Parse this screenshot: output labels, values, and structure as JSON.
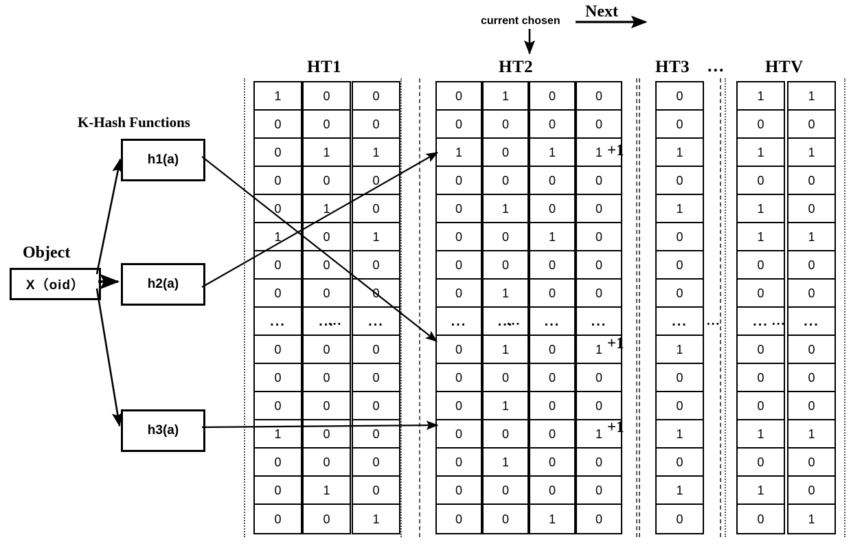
{
  "diagram": {
    "title_labels": {
      "k_hash": "K-Hash Functions",
      "object": "Object",
      "next": "Next",
      "current_chosen": "current chosen"
    },
    "object_box": {
      "label": "X（oid）"
    },
    "hash_boxes": [
      {
        "label": "h1(a)"
      },
      {
        "label": "h2(a)"
      },
      {
        "label": "h3(a)"
      }
    ],
    "ellipsis": "...",
    "plus_one": "+1",
    "group_ellipsis_between_ht3_htv": "...",
    "tables": [
      {
        "name": "HT1",
        "columns": [
          {
            "cells": [
              "1",
              "0",
              "0",
              "0",
              "0",
              "1",
              "0",
              "0",
              "...",
              "0",
              "0",
              "0",
              "1",
              "0",
              "0",
              "0"
            ]
          },
          {
            "cells": [
              "0",
              "0",
              "1",
              "0",
              "1",
              "0",
              "0",
              "0",
              "...",
              "0",
              "0",
              "0",
              "0",
              "0",
              "1",
              "0"
            ]
          },
          {
            "cells": [
              "0",
              "0",
              "1",
              "0",
              "0",
              "1",
              "0",
              "0",
              "...",
              "0",
              "0",
              "0",
              "0",
              "0",
              "0",
              "1"
            ]
          }
        ],
        "gap_after_column": 2
      },
      {
        "name": "HT2",
        "columns": [
          {
            "cells": [
              "0",
              "0",
              "1",
              "0",
              "0",
              "0",
              "0",
              "0",
              "...",
              "0",
              "0",
              "0",
              "0",
              "0",
              "0",
              "0"
            ]
          },
          {
            "cells": [
              "1",
              "0",
              "0",
              "0",
              "1",
              "0",
              "0",
              "1",
              "...",
              "1",
              "0",
              "1",
              "0",
              "1",
              "0",
              "0"
            ]
          },
          {
            "cells": [
              "0",
              "0",
              "1",
              "0",
              "0",
              "1",
              "0",
              "0",
              "...",
              "0",
              "0",
              "0",
              "0",
              "0",
              "0",
              "1"
            ]
          },
          {
            "cells": [
              "0",
              "0",
              "1",
              "0",
              "0",
              "0",
              "0",
              "0",
              "...",
              "1",
              "0",
              "0",
              "1",
              "0",
              "0",
              "0"
            ]
          }
        ],
        "gap_after_column": 2,
        "increment_rows": [
          3,
          10,
          14
        ]
      },
      {
        "name": "HT3",
        "columns": [
          {
            "cells": [
              "0",
              "0",
              "1",
              "0",
              "1",
              "0",
              "0",
              "0",
              "...",
              "1",
              "0",
              "0",
              "1",
              "0",
              "1",
              "0"
            ]
          }
        ]
      },
      {
        "name": "HTV",
        "columns": [
          {
            "cells": [
              "1",
              "0",
              "1",
              "0",
              "1",
              "1",
              "0",
              "0",
              "...",
              "0",
              "0",
              "0",
              "1",
              "0",
              "1",
              "0"
            ]
          },
          {
            "cells": [
              "1",
              "0",
              "1",
              "0",
              "0",
              "1",
              "0",
              "0",
              "...",
              "0",
              "0",
              "0",
              "1",
              "0",
              "0",
              "1"
            ]
          }
        ],
        "gap_after_column": 1
      }
    ]
  }
}
